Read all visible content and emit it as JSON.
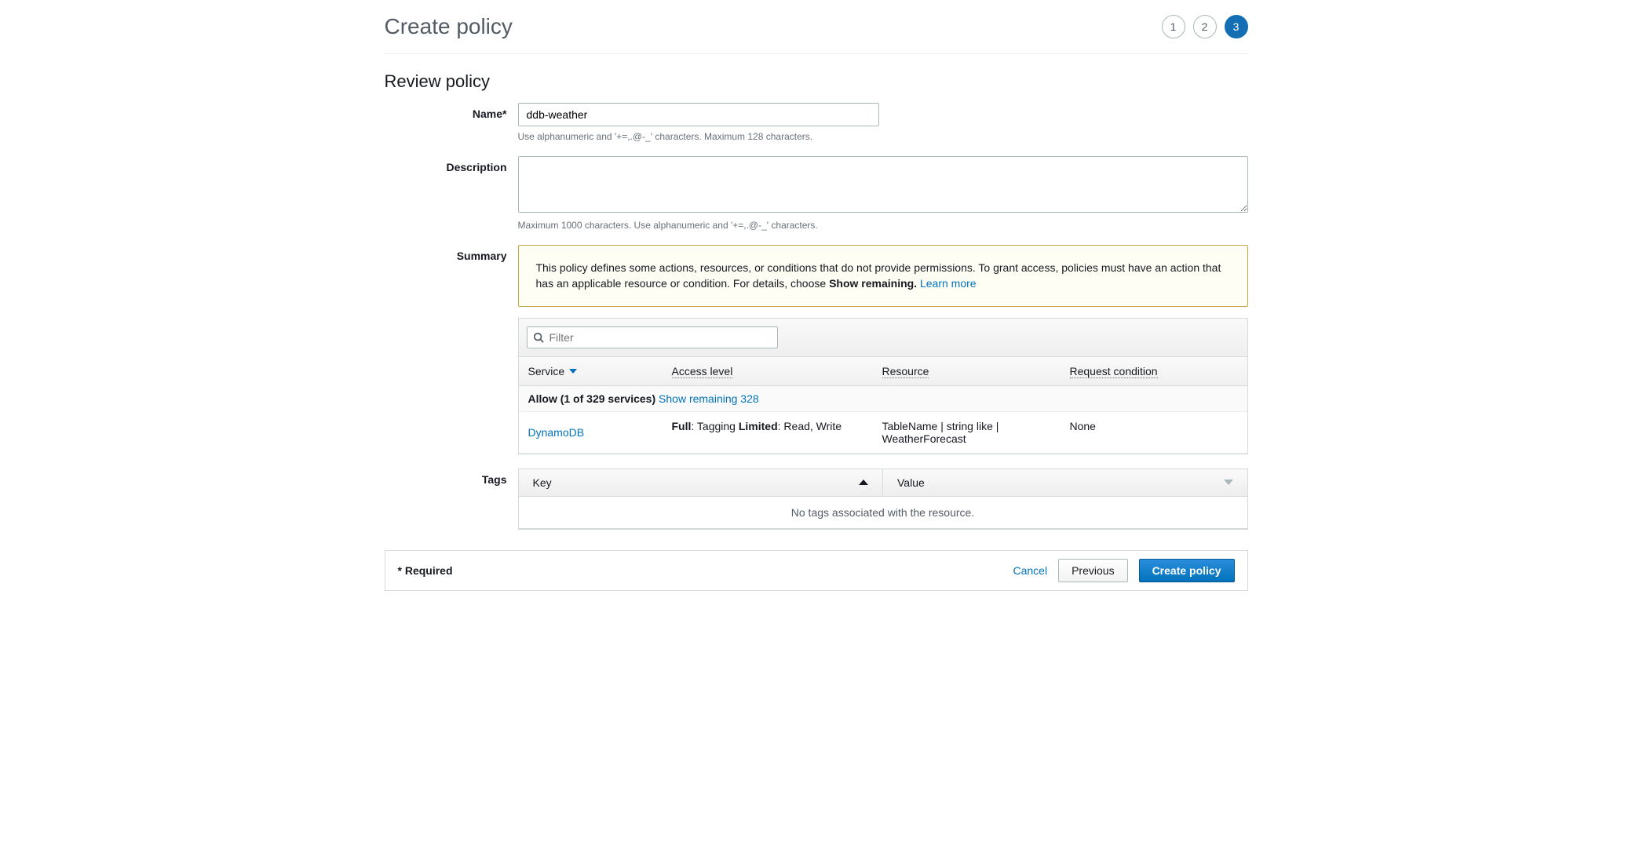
{
  "header": {
    "title": "Create policy",
    "steps": [
      "1",
      "2",
      "3"
    ],
    "active_step": 2
  },
  "section_title": "Review policy",
  "form": {
    "name_label": "Name*",
    "name_value": "ddb-weather",
    "name_hint": "Use alphanumeric and '+=,.@-_' characters. Maximum 128 characters.",
    "description_label": "Description",
    "description_value": "",
    "description_hint": "Maximum 1000 characters. Use alphanumeric and '+=,.@-_' characters.",
    "summary_label": "Summary",
    "tags_label": "Tags"
  },
  "info": {
    "text_a": "This policy defines some actions, resources, or conditions that do not provide permissions. To grant access, policies must have an action that has an applicable resource or condition. For details, choose ",
    "show_remaining": "Show remaining.",
    "learn_more": "Learn more"
  },
  "filter": {
    "placeholder": "Filter"
  },
  "columns": {
    "service": "Service",
    "access_level": "Access level",
    "resource": "Resource",
    "request_condition": "Request condition"
  },
  "allow_row": {
    "label": "Allow (1 of 329 services)",
    "link": "Show remaining 328"
  },
  "rows": [
    {
      "service": "DynamoDB",
      "access_full_label": "Full",
      "access_full_value": ": Tagging ",
      "access_limited_label": "Limited",
      "access_limited_value": ": Read, Write",
      "resource": "TableName | string like | WeatherForecast",
      "condition": "None"
    }
  ],
  "tags": {
    "col_key": "Key",
    "col_value": "Value",
    "empty": "No tags associated with the resource."
  },
  "footer": {
    "required": "* Required",
    "cancel": "Cancel",
    "previous": "Previous",
    "create": "Create policy"
  }
}
